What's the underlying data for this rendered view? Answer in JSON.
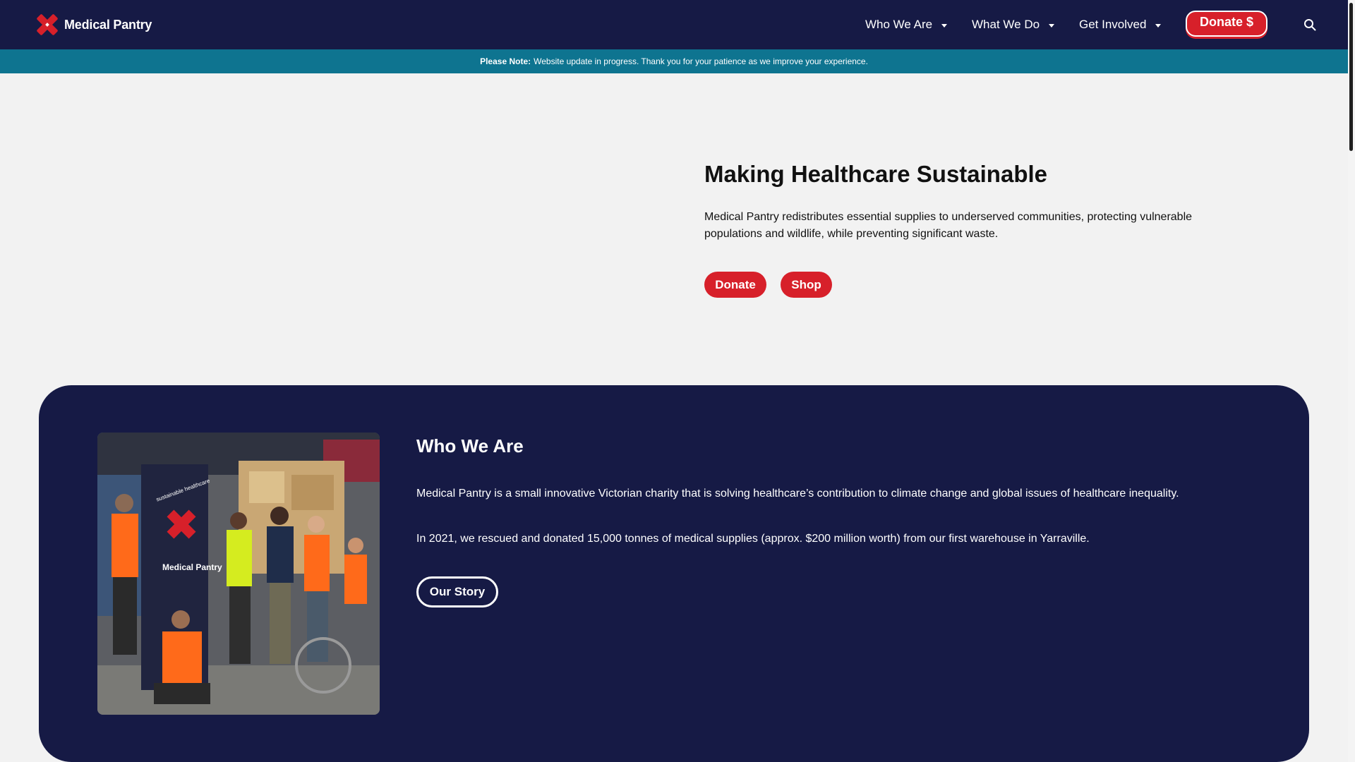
{
  "brand": {
    "name": "Medical Pantry",
    "color_primary": "#d7202a",
    "color_navy": "#161a45",
    "color_teal": "#0e7490"
  },
  "nav": {
    "items": [
      {
        "label": "Who We Are"
      },
      {
        "label": "What We Do"
      },
      {
        "label": "Get Involved"
      }
    ],
    "donate_label": "Donate $",
    "search_icon": "search-icon"
  },
  "notice": {
    "prefix": "Please Note:",
    "message": "Website update in progress. Thank you for your patience as we improve your experience."
  },
  "hero": {
    "title": "Making Healthcare Sustainable",
    "text": "Medical Pantry redistributes essential supplies to underserved communities, protecting vulnerable populations and wildlife, while preventing significant waste.",
    "donate_label": "Donate",
    "shop_label": "Shop"
  },
  "who": {
    "title": "Who We Are",
    "p1": "Medical Pantry is a small innovative Victorian charity that is solving healthcare’s contribution to climate change and global issues of healthcare inequality.",
    "p2": "In 2021, we rescued and donated 15,000 tonnes of medical supplies (approx. $200 million worth) from our first warehouse in Yarraville.",
    "story_label": "Our Story",
    "banner_top": "sustainable healthcare",
    "banner_name": "Medical Pantry"
  }
}
